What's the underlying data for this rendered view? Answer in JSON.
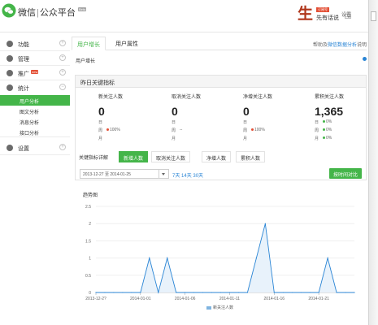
{
  "header": {
    "brand": "微信",
    "separator": "|",
    "product": "公众平台",
    "beta_tag": "Beta",
    "account_badge": "订阅号",
    "account_name": "先有话说",
    "avatar_glyph": "生",
    "top_right": "设置"
  },
  "sidebar": {
    "groups": [
      {
        "label": "功能"
      },
      {
        "label": "管理"
      },
      {
        "label": "推广",
        "badge": "new"
      },
      {
        "label": "统计"
      },
      {
        "label": "设置"
      }
    ],
    "sub_items": [
      {
        "label": "用户分析",
        "active": true
      },
      {
        "label": "图文分析"
      },
      {
        "label": "消息分析"
      },
      {
        "label": "接口分析"
      }
    ]
  },
  "tabs": [
    {
      "label": "用户增长"
    },
    {
      "label": "用户属性"
    }
  ],
  "tab_right": {
    "text": "帮助及",
    "link": "微信数据分析",
    "suffix": "说明"
  },
  "section_title": "用户增长",
  "key_metrics": {
    "title": "昨日关键指标",
    "stats": [
      {
        "label": "新关注人数",
        "value": "0",
        "day_label": "日",
        "week_label": "周",
        "week_value": "100%",
        "month_label": "月",
        "month_value": "",
        "week_trend": "down"
      },
      {
        "label": "取消关注人数",
        "value": "0",
        "day_label": "日",
        "week_label": "周",
        "week_value": "--",
        "month_label": "月",
        "month_value": "",
        "week_trend": "none"
      },
      {
        "label": "净增关注人数",
        "value": "0",
        "day_label": "日",
        "week_label": "周",
        "week_value": "100%",
        "month_label": "月",
        "month_value": "",
        "week_trend": "down"
      },
      {
        "label": "累积关注人数",
        "value": "1,365",
        "day_label": "日",
        "day_value": "0%",
        "week_label": "周",
        "week_value": "0%",
        "month_label": "月",
        "month_value": "0%",
        "week_trend": "up"
      }
    ]
  },
  "trend": {
    "label": "关键指标详解",
    "tabs": [
      {
        "label": "新增人数",
        "active": true
      },
      {
        "label": "取消关注人数"
      },
      {
        "label": "净增人数"
      },
      {
        "label": "累积人数"
      }
    ],
    "date_range": "2013-12-27 至 2014-01-25",
    "quick_links": [
      "7天",
      "14天",
      "30天"
    ],
    "export_label": "按时间对比"
  },
  "chart_title": "趋势图",
  "chart_data": {
    "type": "area",
    "x": [
      "2013-12-27",
      "2013-12-28",
      "2013-12-29",
      "2013-12-30",
      "2013-12-31",
      "2014-01-01",
      "2014-01-02",
      "2014-01-03",
      "2014-01-04",
      "2014-01-05",
      "2014-01-06",
      "2014-01-07",
      "2014-01-08",
      "2014-01-09",
      "2014-01-10",
      "2014-01-11",
      "2014-01-12",
      "2014-01-13",
      "2014-01-14",
      "2014-01-15",
      "2014-01-16",
      "2014-01-17",
      "2014-01-18",
      "2014-01-19",
      "2014-01-20",
      "2014-01-21",
      "2014-01-22",
      "2014-01-23",
      "2014-01-24",
      "2014-01-25"
    ],
    "series": [
      {
        "name": "新关注人数",
        "values": [
          0,
          0,
          0,
          0,
          0,
          0,
          1,
          0,
          1,
          0,
          0,
          0,
          0,
          0,
          0,
          0,
          0,
          0,
          1,
          2,
          0,
          0,
          0,
          0,
          0,
          0,
          1,
          0,
          0,
          0
        ]
      }
    ],
    "yticks": [
      "0",
      "0.5",
      "1",
      "1.5",
      "2",
      "2.5"
    ],
    "ylim": [
      0,
      2.5
    ],
    "xtick_labels": [
      "2013-12-2?",
      "2014-01-01",
      "2014-01-06",
      "2014-01-11",
      "2014-01-16",
      "2014-01-21"
    ],
    "xtick_index": [
      0,
      5,
      10,
      15,
      20,
      25
    ],
    "grid": true,
    "legend": "bottom",
    "colors": {
      "line": "#2a85d5",
      "fill": "#e8f2fb"
    }
  },
  "theme": {
    "accent": "#44b549",
    "link": "#2a85d5",
    "alert": "#e34f35"
  }
}
